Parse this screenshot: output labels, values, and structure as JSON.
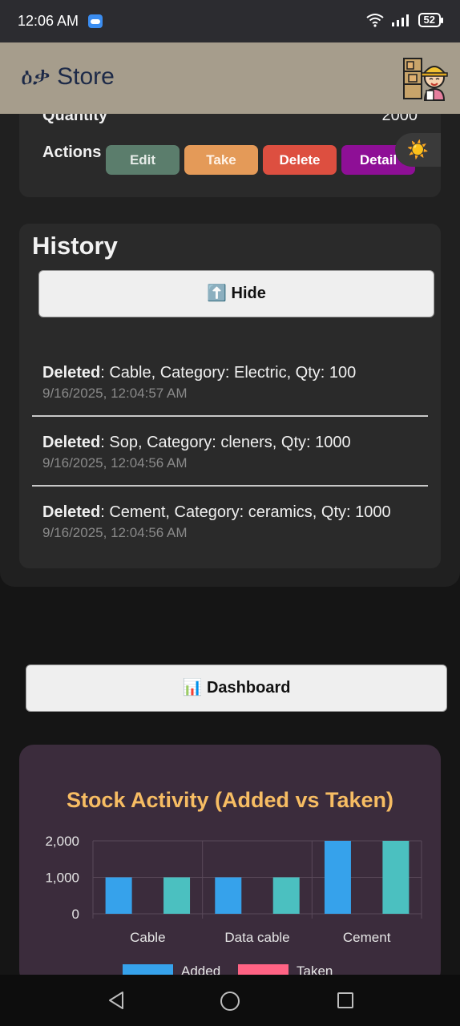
{
  "status_bar": {
    "time": "12:06 AM",
    "battery": "52"
  },
  "app_bar": {
    "title": "ዕቃ Store"
  },
  "item": {
    "quantity_label": "Quantity",
    "quantity_value": "2000",
    "actions_label": "Actions",
    "buttons": {
      "edit": "Edit",
      "take": "Take",
      "delete": "Delete",
      "detail": "Detail"
    },
    "theme_toggle": "☀️"
  },
  "history": {
    "title": "History",
    "hide_button": "⬆️ Hide",
    "entries": [
      {
        "action": "Deleted",
        "text": ": Cable, Category: Electric, Qty: 100",
        "time": "9/16/2025, 12:04:57 AM"
      },
      {
        "action": "Deleted",
        "text": ": Sop, Category: cleners, Qty: 1000",
        "time": "9/16/2025, 12:04:56 AM"
      },
      {
        "action": "Deleted",
        "text": ": Cement, Category: ceramics, Qty: 1000",
        "time": "9/16/2025, 12:04:56 AM"
      }
    ]
  },
  "dashboard": {
    "button": "📊 Dashboard"
  },
  "chart_data": {
    "type": "bar",
    "title": "Stock Activity (Added vs Taken)",
    "categories": [
      "Cable",
      "Data cable",
      "Cement"
    ],
    "series": [
      {
        "name": "Added",
        "values": [
          1000,
          1000,
          2000
        ],
        "color": "#36a2eb"
      },
      {
        "name": "Taken",
        "values": [
          1000,
          1000,
          2000
        ],
        "color": "#4bc0c0",
        "legend_color": "#ff6384"
      }
    ],
    "ylim": [
      0,
      2000
    ],
    "yticks": [
      "0",
      "1,000",
      "2,000"
    ],
    "grid": true,
    "legend_placement": "bottom"
  }
}
